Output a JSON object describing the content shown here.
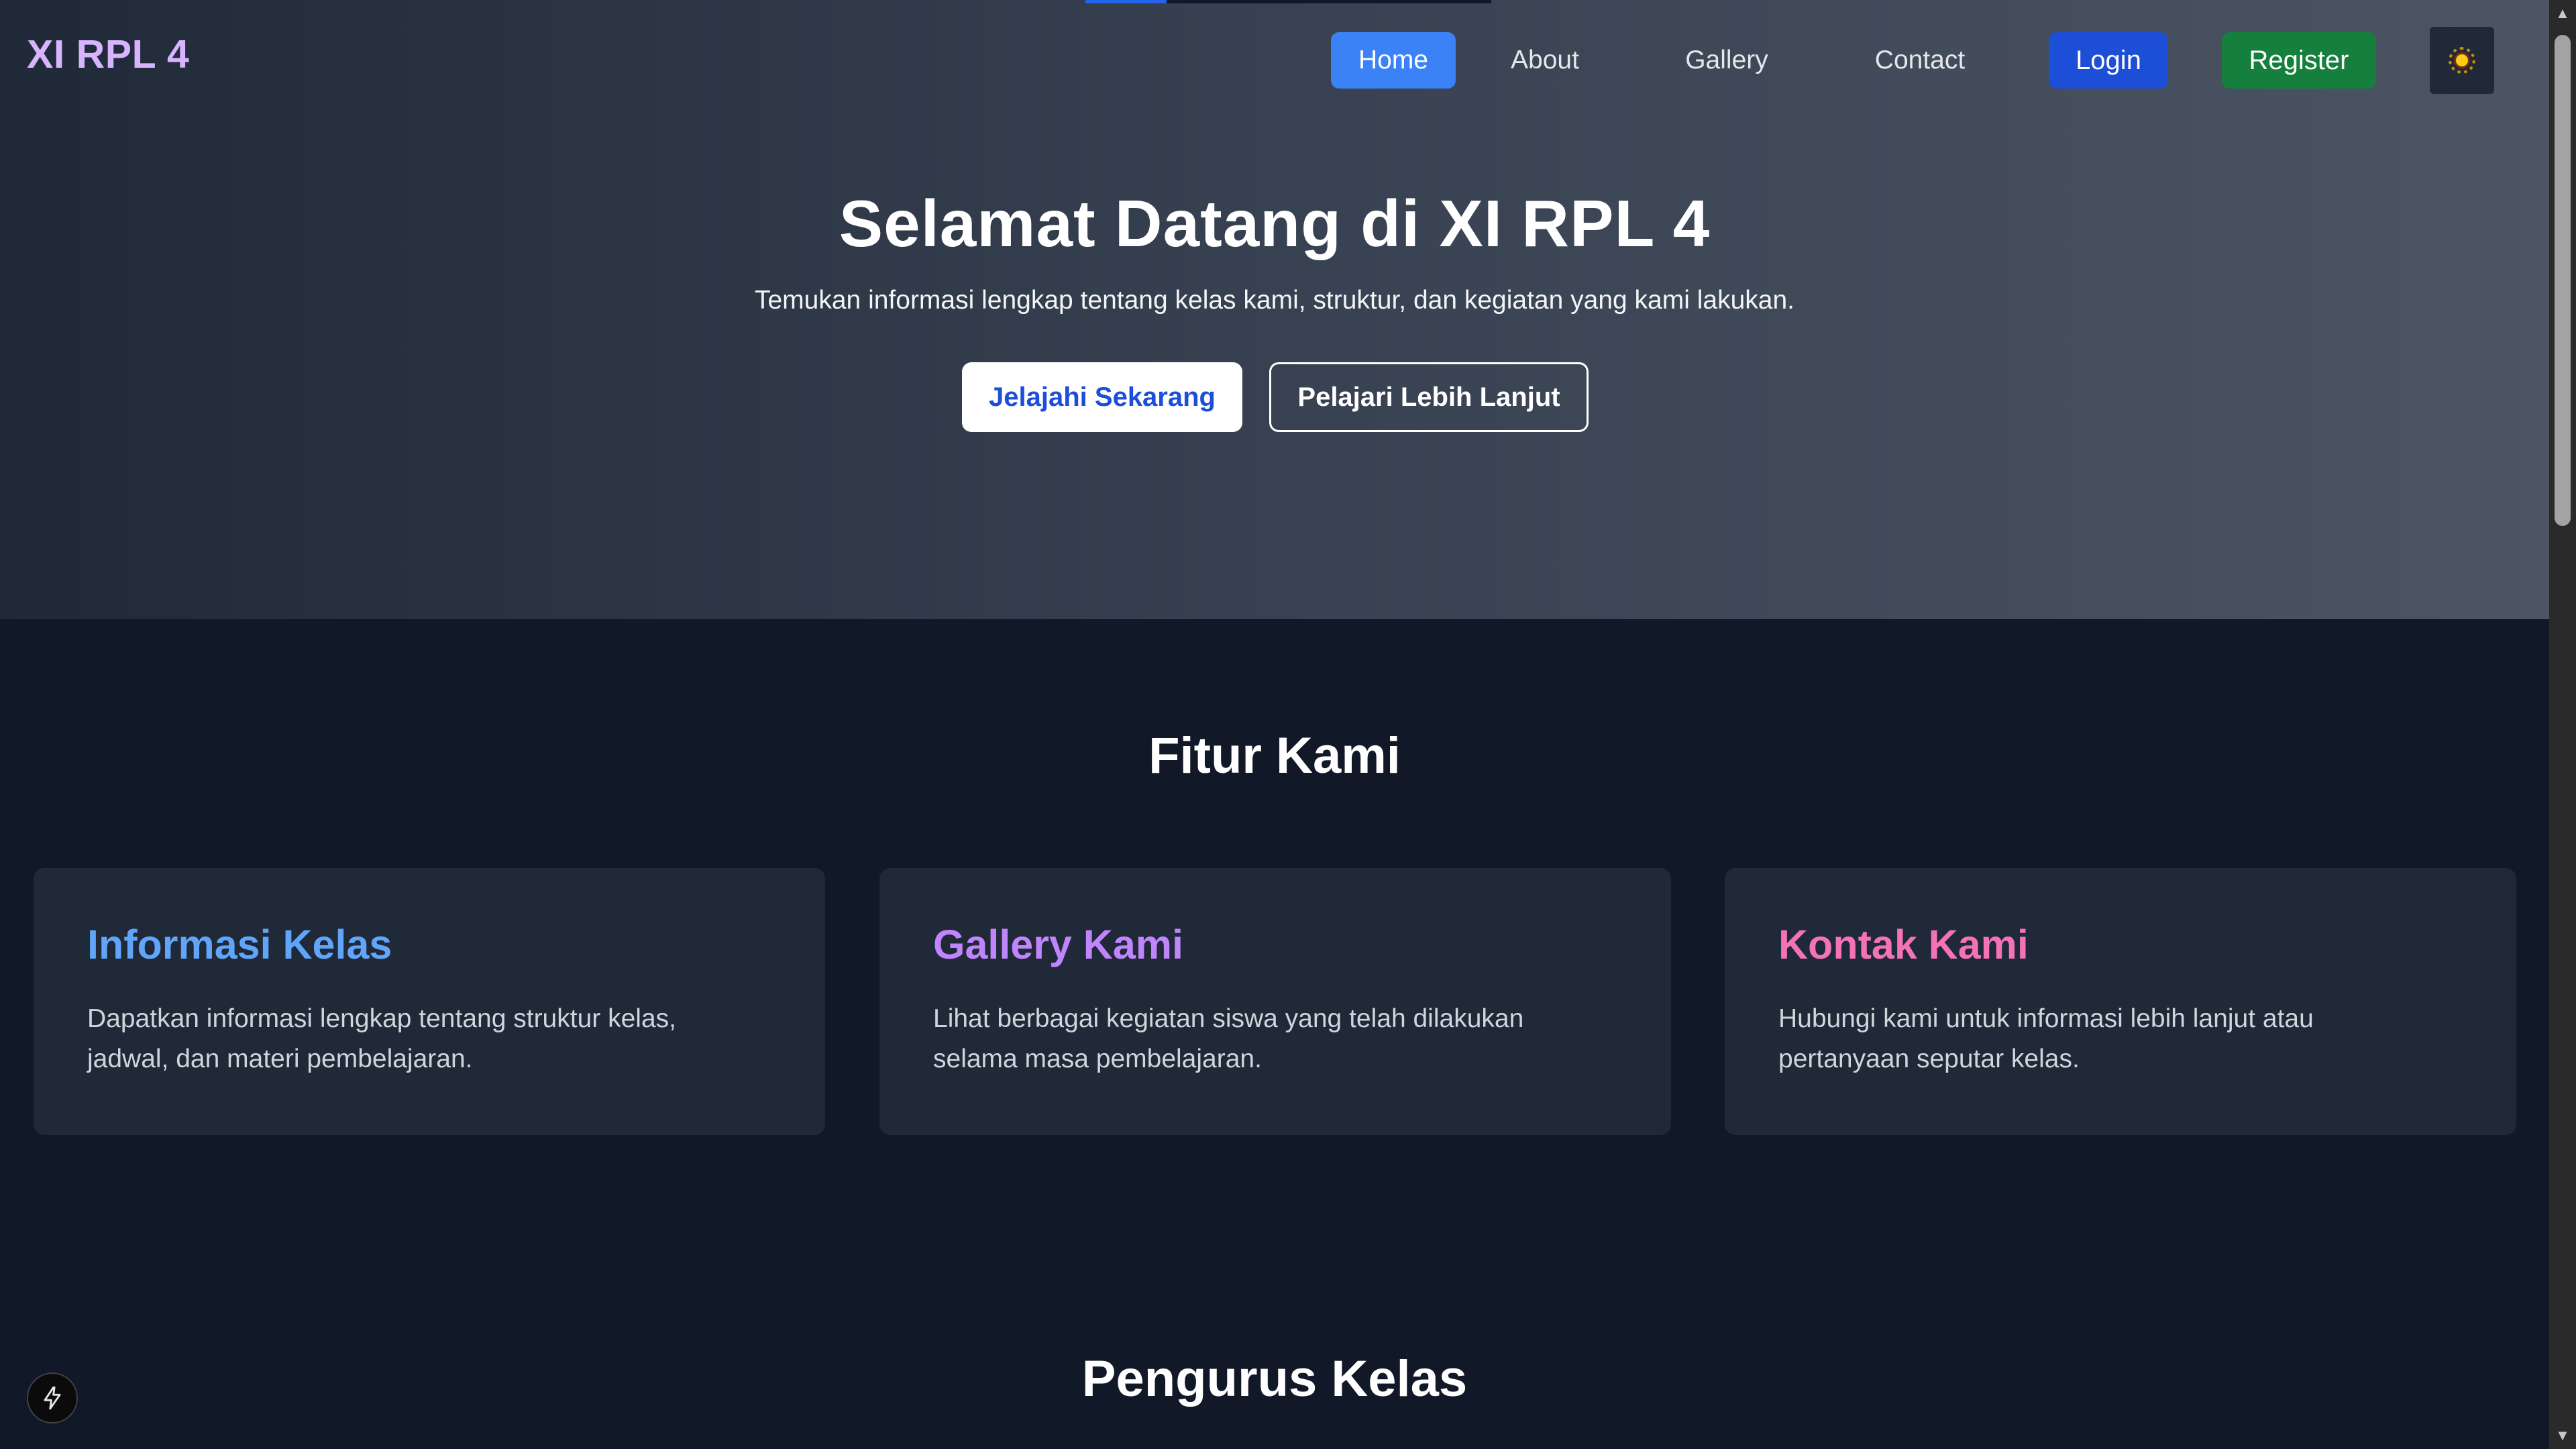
{
  "brand": "XI RPL 4",
  "nav": {
    "home": "Home",
    "about": "About",
    "gallery": "Gallery",
    "contact": "Contact",
    "login": "Login",
    "register": "Register",
    "theme_icon": "sun-icon"
  },
  "hero": {
    "title": "Selamat Datang di XI RPL 4",
    "subtitle": "Temukan informasi lengkap tentang kelas kami, struktur, dan kegiatan yang kami lakukan.",
    "primary_cta": "Jelajahi Sekarang",
    "secondary_cta": "Pelajari Lebih Lanjut"
  },
  "features": {
    "title": "Fitur Kami",
    "cards": [
      {
        "title": "Informasi Kelas",
        "text": "Dapatkan informasi lengkap tentang struktur kelas, jadwal, dan materi pembelajaran.",
        "color": "#60a5fa"
      },
      {
        "title": "Gallery Kami",
        "text": "Lihat berbagai kegiatan siswa yang telah dilakukan selama masa pembelajaran.",
        "color": "#c084fc"
      },
      {
        "title": "Kontak Kami",
        "text": "Hubungi kami untuk informasi lebih lanjut atau pertanyaan seputar kelas.",
        "color": "#f472b6"
      }
    ]
  },
  "officers": {
    "title": "Pengurus Kelas"
  },
  "colors": {
    "accent": "#3b82f6",
    "login": "#1d4ed8",
    "register": "#15803d",
    "brand": "#d8b4fe",
    "background": "#111827",
    "card": "#1f2937"
  },
  "top_progress": 0.2
}
